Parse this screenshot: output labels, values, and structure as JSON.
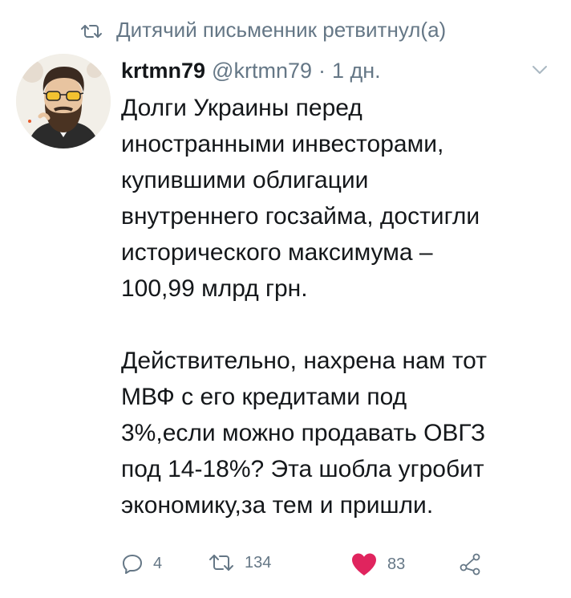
{
  "retweet_context": {
    "icon": "retweet-icon",
    "text": "Дитячий письменник ретвитнул(а)"
  },
  "tweet": {
    "author": {
      "name": "krtmn79",
      "handle": "@krtmn79",
      "avatar_icon": "bearded-man-sunglasses-avatar"
    },
    "separator": "·",
    "time": "1 дн.",
    "menu_icon": "chevron-down-icon",
    "text": {
      "paragraph_1": "Долги Украины перед\nиностранными инвесторами,\nкупившими облигации\nвнутреннего госзайма, достигли\nисторического максимума –\n100,99 млрд грн.",
      "paragraph_2": "Действительно, нахрена нам тот\nМВФ с его кредитами под\n3%,если можно продавать ОВГЗ\nпод 14-18%? Эта шобла угробит\nэкономику,за тем и пришли."
    },
    "actions": {
      "reply": {
        "icon": "reply-icon",
        "count": "4"
      },
      "retweet": {
        "icon": "retweet-icon",
        "count": "134"
      },
      "like": {
        "icon": "heart-icon",
        "count": "83",
        "color": "#e0245e",
        "liked": true
      },
      "share": {
        "icon": "share-icon"
      }
    }
  },
  "colors": {
    "text": "#14171a",
    "secondary": "#657786",
    "like_red": "#e0245e"
  }
}
